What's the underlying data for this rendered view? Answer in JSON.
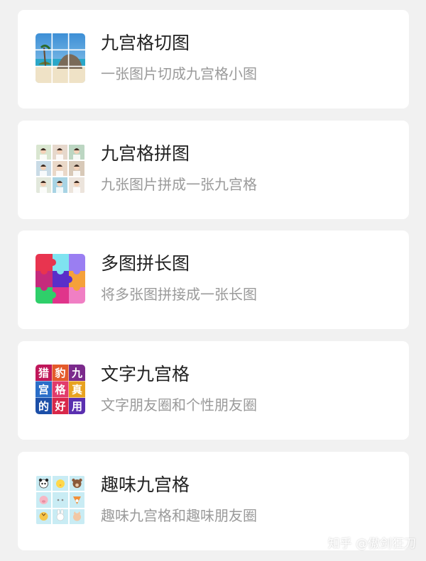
{
  "items": [
    {
      "title": "九宫格切图",
      "subtitle": "一张图片切成九宫格小图",
      "icon": "beach-photo-grid-icon"
    },
    {
      "title": "九宫格拼图",
      "subtitle": "九张图片拼成一张九宫格",
      "icon": "portrait-collage-grid-icon"
    },
    {
      "title": "多图拼长图",
      "subtitle": "将多张图拼接成一张长图",
      "icon": "colorful-puzzle-icon"
    },
    {
      "title": "文字九宫格",
      "subtitle": "文字朋友圈和个性朋友圈",
      "icon": "text-grid-icon",
      "icon_text": [
        "猎",
        "豹",
        "九",
        "宫",
        "格",
        "真",
        "的",
        "好",
        "用"
      ]
    },
    {
      "title": "趣味九宫格",
      "subtitle": "趣味九宫格和趣味朋友圈",
      "icon": "animal-stickers-grid-icon"
    }
  ],
  "watermark": "知乎 @傲剑狂刀"
}
